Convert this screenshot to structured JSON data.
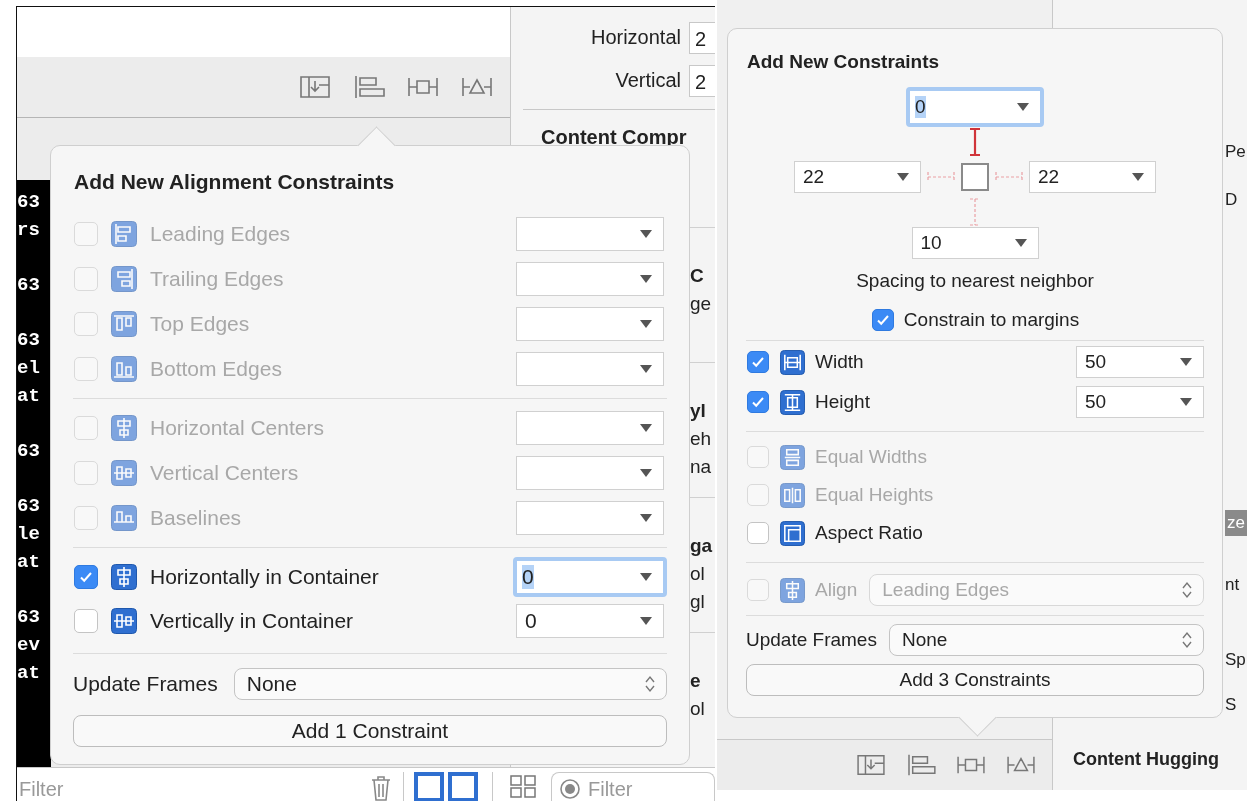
{
  "left_window": {
    "inspector": {
      "rows": [
        {
          "label": "Horizontal",
          "value": "2"
        },
        {
          "label": "Vertical",
          "value": "2"
        }
      ],
      "section_title": "Content Compr"
    },
    "console_lines": [
      [
        "63",
        "rs"
      ],
      [
        "63"
      ],
      [
        "63",
        "el",
        "at"
      ],
      [
        "63"
      ],
      [
        "63",
        "le",
        "at"
      ],
      [
        "63",
        "ev",
        "at"
      ]
    ],
    "peek_sections": [
      {
        "title": "C",
        "lines": [
          "ge"
        ]
      },
      {
        "title": "yl",
        "lines": [
          "eh",
          "na"
        ]
      },
      {
        "title": "ga",
        "lines": [
          "ol",
          "gl"
        ]
      },
      {
        "title": "e",
        "lines": [
          "ol"
        ]
      }
    ],
    "bottom_bar": {
      "filter_placeholder": "Filter",
      "search_placeholder": "Filter"
    },
    "popover": {
      "title": "Add New Alignment Constraints",
      "groups": [
        {
          "items": [
            {
              "label": "Leading Edges",
              "checked": false,
              "disabled": true,
              "focused": false
            },
            {
              "label": "Trailing Edges",
              "checked": false,
              "disabled": true,
              "focused": false
            },
            {
              "label": "Top Edges",
              "checked": false,
              "disabled": true,
              "focused": false
            },
            {
              "label": "Bottom Edges",
              "checked": false,
              "disabled": true,
              "focused": false
            }
          ]
        },
        {
          "items": [
            {
              "label": "Horizontal Centers",
              "checked": false,
              "disabled": true,
              "focused": false
            },
            {
              "label": "Vertical Centers",
              "checked": false,
              "disabled": true,
              "focused": false
            },
            {
              "label": "Baselines",
              "checked": false,
              "disabled": true,
              "focused": false
            }
          ]
        },
        {
          "items": [
            {
              "label": "Horizontally in Container",
              "checked": true,
              "disabled": false,
              "value": "0",
              "focused": true
            },
            {
              "label": "Vertically in Container",
              "checked": false,
              "disabled": false,
              "value": "0",
              "focused": false
            }
          ]
        }
      ],
      "update_frames": {
        "label": "Update Frames",
        "value": "None"
      },
      "button": "Add 1 Constraint"
    }
  },
  "right_window": {
    "inspector_fragments": [
      "Pe",
      "D",
      "ze",
      "nt",
      "Sp",
      "S"
    ],
    "section_title": "Content Hugging",
    "popover": {
      "title": "Add New Constraints",
      "spacing": {
        "top": {
          "value": "0",
          "focused": true,
          "pinned": true
        },
        "left": {
          "value": "22",
          "focused": false,
          "pinned": false
        },
        "right": {
          "value": "22",
          "focused": false,
          "pinned": false
        },
        "bottom": {
          "value": "10",
          "focused": false,
          "pinned": false
        }
      },
      "spacing_caption": "Spacing to nearest neighbor",
      "constrain_to_margins": {
        "label": "Constrain to margins",
        "checked": true
      },
      "size_items": [
        {
          "label": "Width",
          "checked": true,
          "disabled": false,
          "value": "50",
          "focused": false
        },
        {
          "label": "Height",
          "checked": true,
          "disabled": false,
          "value": "50",
          "focused": false
        }
      ],
      "equal_items": [
        {
          "label": "Equal Widths",
          "checked": false,
          "disabled": true
        },
        {
          "label": "Equal Heights",
          "checked": false,
          "disabled": true
        },
        {
          "label": "Aspect Ratio",
          "checked": false,
          "disabled": false
        }
      ],
      "align": {
        "label": "Align",
        "value": "Leading Edges",
        "checked": false,
        "disabled": true
      },
      "update_frames": {
        "label": "Update Frames",
        "value": "None"
      },
      "button": "Add 3 Constraints"
    }
  }
}
